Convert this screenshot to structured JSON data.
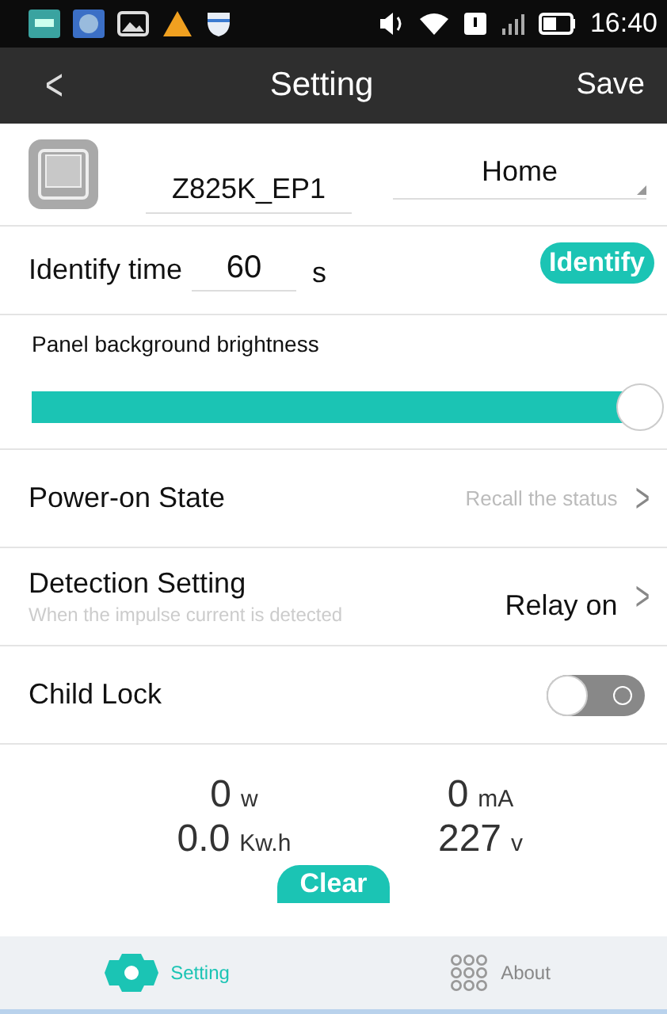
{
  "status_bar": {
    "time": "16:40"
  },
  "header": {
    "back": "<",
    "title": "Setting",
    "action": "Save"
  },
  "device": {
    "name": "Z825K_EP1",
    "room": "Home"
  },
  "identify": {
    "label": "Identify time",
    "value": "60",
    "unit": "s",
    "button": "Identify"
  },
  "brightness": {
    "label": "Panel background brightness",
    "level": 1.0
  },
  "rows": [
    {
      "kind": "link",
      "title": "Power-on State",
      "value": "Recall the status",
      "muted": true,
      "chevron": ">"
    },
    {
      "kind": "link",
      "title": "Detection Setting",
      "subtitle": "When the impulse current is detected",
      "value": "Relay on",
      "muted": false,
      "chevron": ">"
    },
    {
      "kind": "toggle",
      "title": "Child Lock",
      "on": false
    }
  ],
  "readings": [
    {
      "value": "0",
      "unit": "w"
    },
    {
      "value": "0",
      "unit": "mA"
    },
    {
      "value": "0.0",
      "unit": "Kw.h"
    },
    {
      "value": "227",
      "unit": "v"
    }
  ],
  "clear_button": "Clear",
  "tabs": [
    {
      "label": "Setting",
      "selected": true
    },
    {
      "label": "About",
      "selected": false
    }
  ]
}
